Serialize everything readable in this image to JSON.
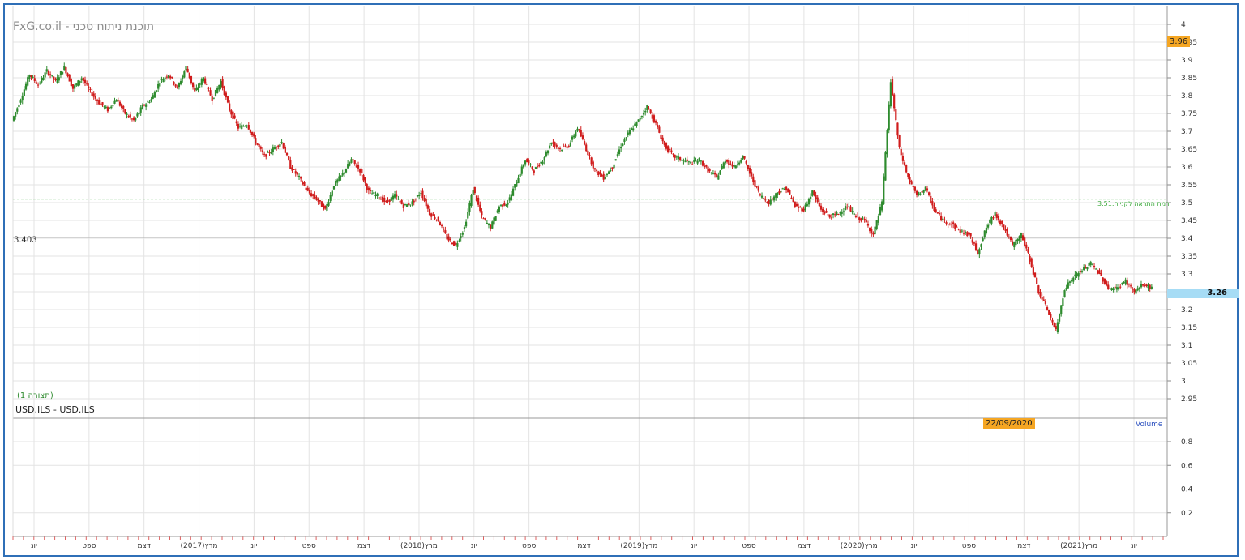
{
  "brand": "FxG.co.il - תוכנת ניתוח טכני",
  "symbol": "USD.ILS - USD.ILS",
  "view_label": "(תצורה 1)",
  "reference_line_label": "3.403",
  "alert_line_label": "רמת התראה לקנייה:3.51",
  "top_badge": "3.96",
  "last_price_badge": "3.26",
  "date_badge": "22/09/2020",
  "volume_label": "Volume",
  "colors": {
    "up": "#2e8b2e",
    "down": "#d01c1c",
    "frame": "#2f6fb7",
    "badge_orange": "#f5a623",
    "badge_blue": "#a6dcf5",
    "grid": "#e3e3e3",
    "alert_line": "#3aa83a"
  },
  "chart_data": {
    "type": "candlestick",
    "title": "",
    "y_ticks": [
      "4",
      "3.95",
      "3.9",
      "3.85",
      "3.8",
      "3.75",
      "3.7",
      "3.65",
      "3.6",
      "3.55",
      "3.5",
      "3.45",
      "3.4",
      "3.35",
      "3.3",
      "3.25",
      "3.2",
      "3.15",
      "3.1",
      "3.05",
      "3",
      "2.95"
    ],
    "ylim": [
      2.95,
      4.0
    ],
    "volume_ticks": [
      "0.8",
      "0.6",
      "0.4",
      "0.2"
    ],
    "x_ticks": [
      "יונ",
      "ספט",
      "דצמ",
      "(2017)מרץ",
      "יונ",
      "ספט",
      "דצמ",
      "(2018)מרץ",
      "יונ",
      "ספט",
      "דצמ",
      "(2019)מרץ",
      "יונ",
      "ספט",
      "דצמ",
      "(2020)מרץ",
      "יונ",
      "ספט",
      "דצמ",
      "(2021)מרץ",
      "יונ"
    ],
    "reference_level": 3.403,
    "alert_level": 3.51,
    "last_price": 3.26,
    "close_path": [
      3.73,
      3.79,
      3.86,
      3.83,
      3.87,
      3.84,
      3.88,
      3.82,
      3.85,
      3.81,
      3.78,
      3.76,
      3.79,
      3.75,
      3.73,
      3.77,
      3.79,
      3.84,
      3.86,
      3.82,
      3.88,
      3.81,
      3.85,
      3.79,
      3.84,
      3.76,
      3.71,
      3.72,
      3.67,
      3.63,
      3.65,
      3.67,
      3.6,
      3.57,
      3.53,
      3.51,
      3.48,
      3.55,
      3.58,
      3.62,
      3.59,
      3.53,
      3.52,
      3.5,
      3.52,
      3.49,
      3.5,
      3.53,
      3.47,
      3.45,
      3.4,
      3.38,
      3.43,
      3.54,
      3.46,
      3.43,
      3.49,
      3.5,
      3.56,
      3.62,
      3.59,
      3.62,
      3.67,
      3.65,
      3.66,
      3.71,
      3.65,
      3.59,
      3.57,
      3.6,
      3.66,
      3.7,
      3.73,
      3.77,
      3.72,
      3.66,
      3.63,
      3.62,
      3.61,
      3.62,
      3.59,
      3.57,
      3.62,
      3.6,
      3.63,
      3.57,
      3.52,
      3.5,
      3.53,
      3.54,
      3.49,
      3.48,
      3.53,
      3.48,
      3.46,
      3.47,
      3.49,
      3.46,
      3.45,
      3.41,
      3.5,
      3.84,
      3.65,
      3.57,
      3.52,
      3.54,
      3.48,
      3.45,
      3.44,
      3.42,
      3.41,
      3.36,
      3.43,
      3.47,
      3.43,
      3.38,
      3.41,
      3.34,
      3.25,
      3.2,
      3.14,
      3.26,
      3.29,
      3.31,
      3.33,
      3.3,
      3.26,
      3.26,
      3.28,
      3.25,
      3.27,
      3.26
    ]
  }
}
